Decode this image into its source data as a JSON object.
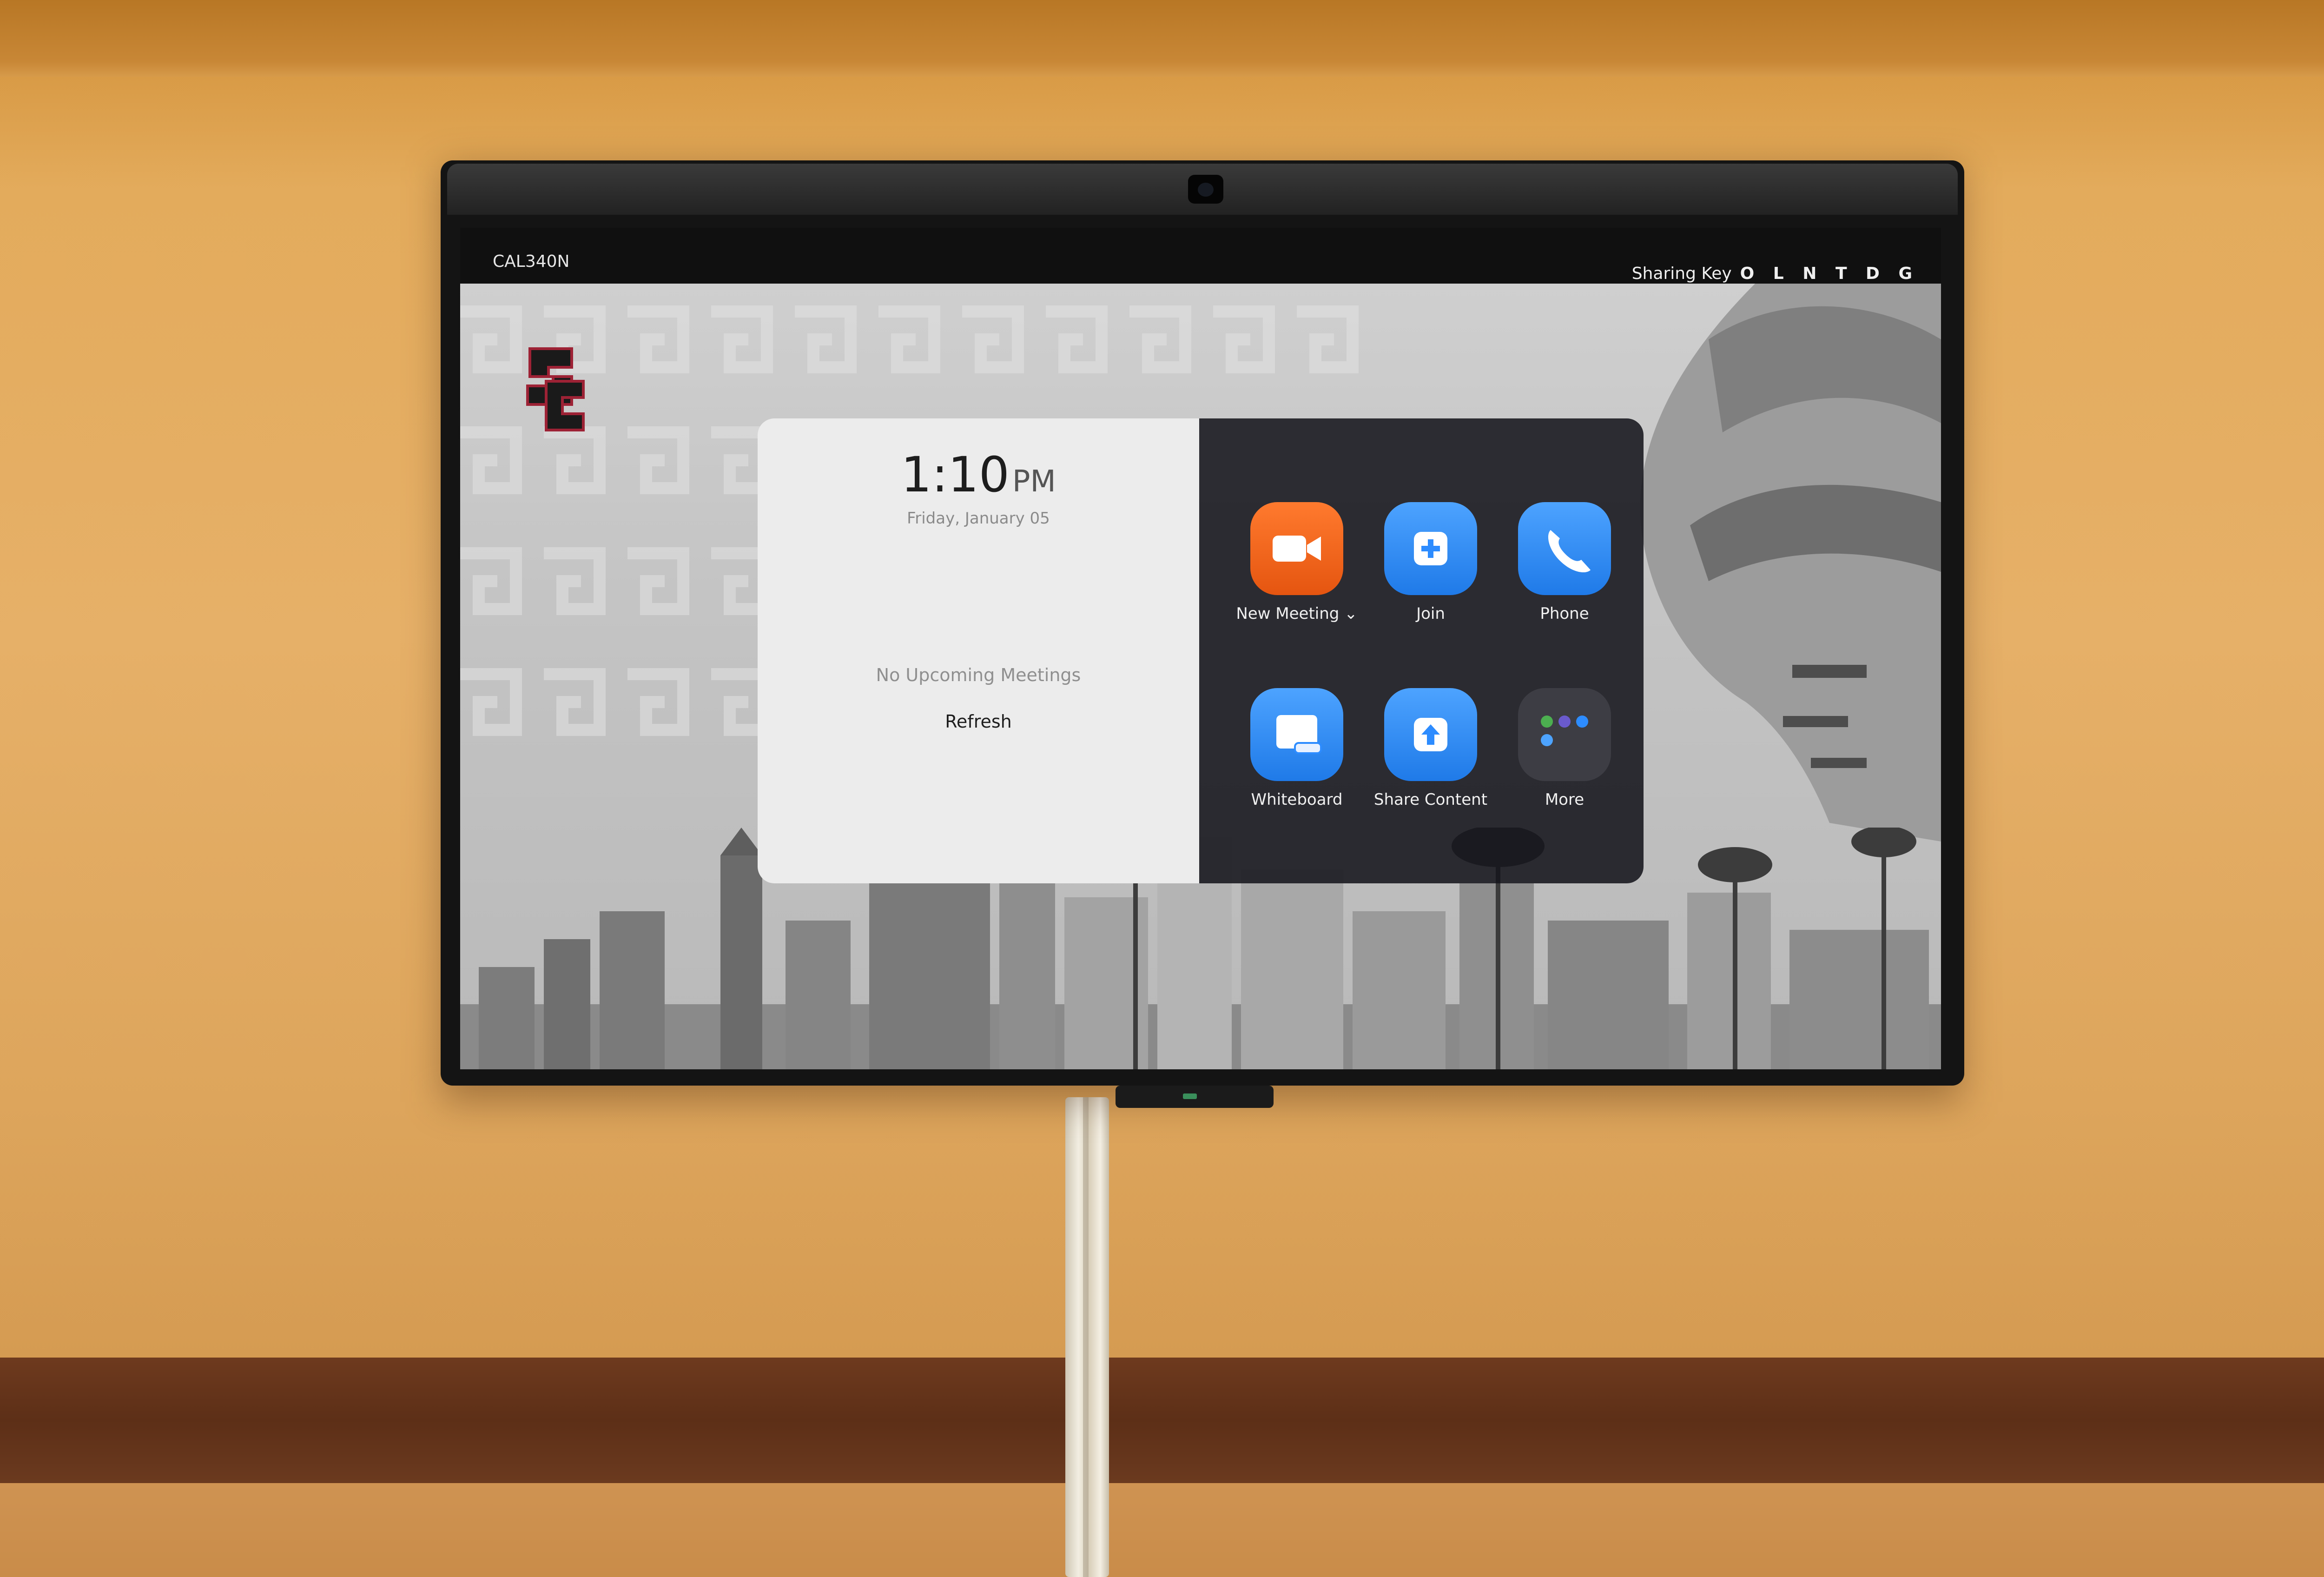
{
  "device": {
    "room_name": "CAL340N",
    "sharing_key_label": "Sharing Key",
    "sharing_key_value": "O L N T D G"
  },
  "clock": {
    "time": "1:10",
    "ampm": "PM",
    "date": "Friday, January 05"
  },
  "meetings": {
    "empty_text": "No Upcoming Meetings",
    "refresh_label": "Refresh"
  },
  "actions": [
    {
      "label": "New Meeting",
      "icon": "video-camera-icon",
      "color": "#f26a21"
    },
    {
      "label": "Join",
      "icon": "plus-icon",
      "color": "#2d8cff"
    },
    {
      "label": "Phone",
      "icon": "phone-icon",
      "color": "#2d8cff"
    },
    {
      "label": "Whiteboard",
      "icon": "whiteboard-icon",
      "color": "#2d8cff"
    },
    {
      "label": "Share Content",
      "icon": "share-upload-icon",
      "color": "#2d8cff"
    },
    {
      "label": "More",
      "icon": "apps-grid-icon",
      "color": "#3d3d44"
    }
  ],
  "logo": {
    "text": "SC",
    "colors": [
      "#1a1a1a",
      "#9d2235"
    ]
  }
}
